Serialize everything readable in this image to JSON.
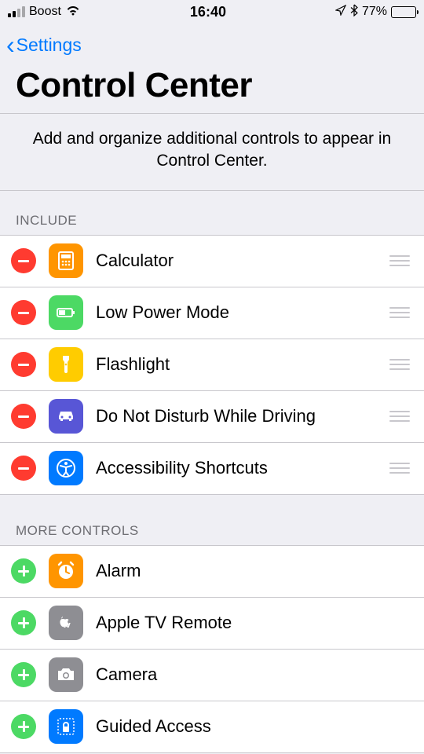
{
  "statusBar": {
    "carrier": "Boost",
    "time": "16:40",
    "batteryPct": "77%"
  },
  "nav": {
    "backLabel": "Settings"
  },
  "page": {
    "title": "Control Center",
    "description": "Add and organize additional controls to appear in Control Center."
  },
  "sections": {
    "includeHeader": "INCLUDE",
    "moreHeader": "MORE CONTROLS"
  },
  "include": [
    {
      "label": "Calculator",
      "icon": "calculator",
      "bg": "bg-orange"
    },
    {
      "label": "Low Power Mode",
      "icon": "battery",
      "bg": "bg-green"
    },
    {
      "label": "Flashlight",
      "icon": "flashlight",
      "bg": "bg-yellow"
    },
    {
      "label": "Do Not Disturb While Driving",
      "icon": "car",
      "bg": "bg-purple"
    },
    {
      "label": "Accessibility Shortcuts",
      "icon": "accessibility",
      "bg": "bg-blue"
    }
  ],
  "more": [
    {
      "label": "Alarm",
      "icon": "alarm",
      "bg": "bg-orange"
    },
    {
      "label": "Apple TV Remote",
      "icon": "appletv",
      "bg": "bg-gray"
    },
    {
      "label": "Camera",
      "icon": "camera",
      "bg": "bg-gray"
    },
    {
      "label": "Guided Access",
      "icon": "lock",
      "bg": "bg-blue-outline"
    }
  ]
}
